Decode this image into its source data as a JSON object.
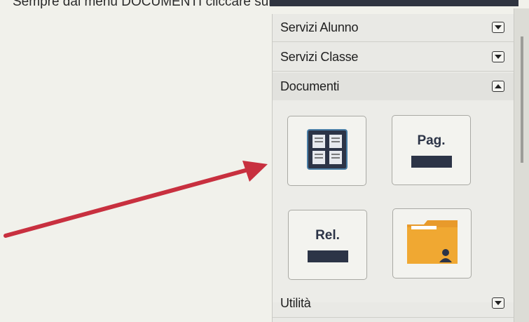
{
  "caption": {
    "text": "Sempre dal menu DOCUMENTI cliccare sul Icona"
  },
  "menu": {
    "sections": [
      {
        "label": "Servizi Alunno",
        "state": "collapsed"
      },
      {
        "label": "Servizi Classe",
        "state": "collapsed"
      },
      {
        "label": "Documenti",
        "state": "expanded"
      }
    ],
    "footer_section": {
      "label": "Utilità",
      "state": "collapsed"
    }
  },
  "documents": {
    "tiles": [
      {
        "icon": "document-grid-icon"
      },
      {
        "label": "Pag.",
        "icon": "pagella-icon"
      },
      {
        "label": "Rel.",
        "icon": "relazione-icon"
      },
      {
        "icon": "student-folder-icon"
      }
    ]
  },
  "colors": {
    "arrow": "#c8303f",
    "tile_dark": "#2c3447",
    "folder": "#f0a832"
  }
}
